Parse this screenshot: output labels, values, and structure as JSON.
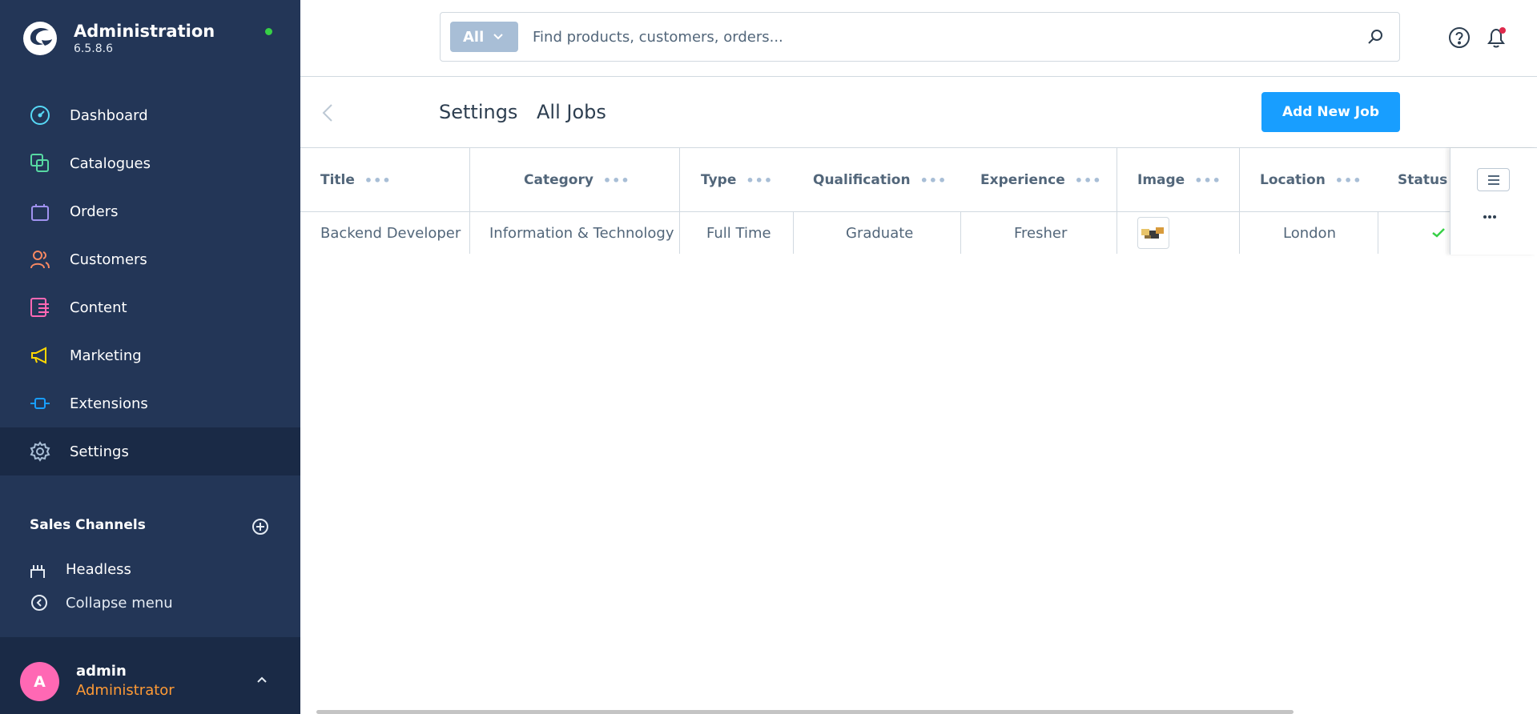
{
  "app": {
    "title": "Administration",
    "version": "6.5.8.6",
    "status_color": "#37d046"
  },
  "sidebar": {
    "items": [
      {
        "label": "Dashboard",
        "icon": "dashboard-icon",
        "color": "#57d9f6"
      },
      {
        "label": "Catalogues",
        "icon": "catalogue-icon",
        "color": "#57d9a3"
      },
      {
        "label": "Orders",
        "icon": "shopping-bag-icon",
        "color": "#a092f0"
      },
      {
        "label": "Customers",
        "icon": "users-icon",
        "color": "#f88962"
      },
      {
        "label": "Content",
        "icon": "content-icon",
        "color": "#ff68b4"
      },
      {
        "label": "Marketing",
        "icon": "megaphone-icon",
        "color": "#ffd700"
      },
      {
        "label": "Extensions",
        "icon": "plug-icon",
        "color": "#189eff"
      },
      {
        "label": "Settings",
        "icon": "gear-icon",
        "color": "#a8bed6",
        "active": true
      }
    ],
    "sales_channels": {
      "title": "Sales Channels",
      "items": [
        {
          "label": "Headless"
        }
      ]
    },
    "collapse_label": "Collapse menu"
  },
  "user": {
    "initial": "A",
    "name": "admin",
    "role": "Administrator"
  },
  "search": {
    "type_label": "All",
    "placeholder": "Find products, customers, orders..."
  },
  "smartbar": {
    "breadcrumb_parent": "Settings",
    "title": "All Jobs",
    "add_button": "Add New Job"
  },
  "table": {
    "columns": [
      "Title",
      "Category",
      "Type",
      "Qualification",
      "Experience",
      "Image",
      "Location",
      "Status"
    ],
    "rows": [
      {
        "title": "Backend Developer",
        "category": "Information & Technology",
        "type": "Full Time",
        "qualification": "Graduate",
        "experience": "Fresher",
        "location": "London",
        "status": "active"
      }
    ]
  }
}
